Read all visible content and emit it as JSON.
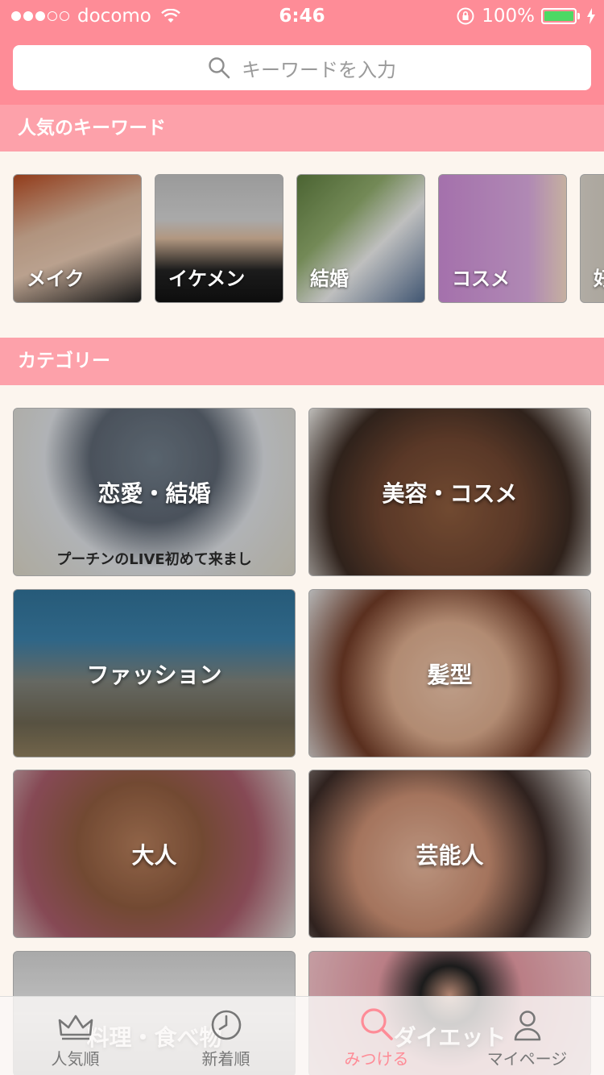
{
  "status_bar": {
    "carrier": "docomo",
    "time": "6:46",
    "battery": "100%",
    "signal_bars_filled": 3,
    "signal_bars_total": 5
  },
  "search": {
    "placeholder": "キーワードを入力"
  },
  "popular_keywords": {
    "title": "人気のキーワード",
    "items": [
      {
        "label": "メイク"
      },
      {
        "label": "イケメン"
      },
      {
        "label": "結婚"
      },
      {
        "label": "コスメ"
      },
      {
        "label": "好"
      }
    ]
  },
  "categories": {
    "title": "カテゴリー",
    "items": [
      {
        "label": "恋愛・結婚",
        "caption": "プーチンのLIVE初めて来まし"
      },
      {
        "label": "美容・コスメ"
      },
      {
        "label": "ファッション"
      },
      {
        "label": "髪型"
      },
      {
        "label": "大人"
      },
      {
        "label": "芸能人"
      },
      {
        "label": "料理・食べ物"
      },
      {
        "label": "ダイエット"
      }
    ]
  },
  "tab_bar": {
    "active": "みつける",
    "tabs": [
      {
        "label": "人気順",
        "icon": "crown-icon"
      },
      {
        "label": "新着順",
        "icon": "clock-icon"
      },
      {
        "label": "みつける",
        "icon": "search-icon"
      },
      {
        "label": "マイページ",
        "icon": "person-icon"
      }
    ]
  },
  "colors": {
    "brand": "#fe8c97",
    "section_header": "#fda1aa",
    "background": "#fcf5ee",
    "battery": "#4cd964"
  }
}
